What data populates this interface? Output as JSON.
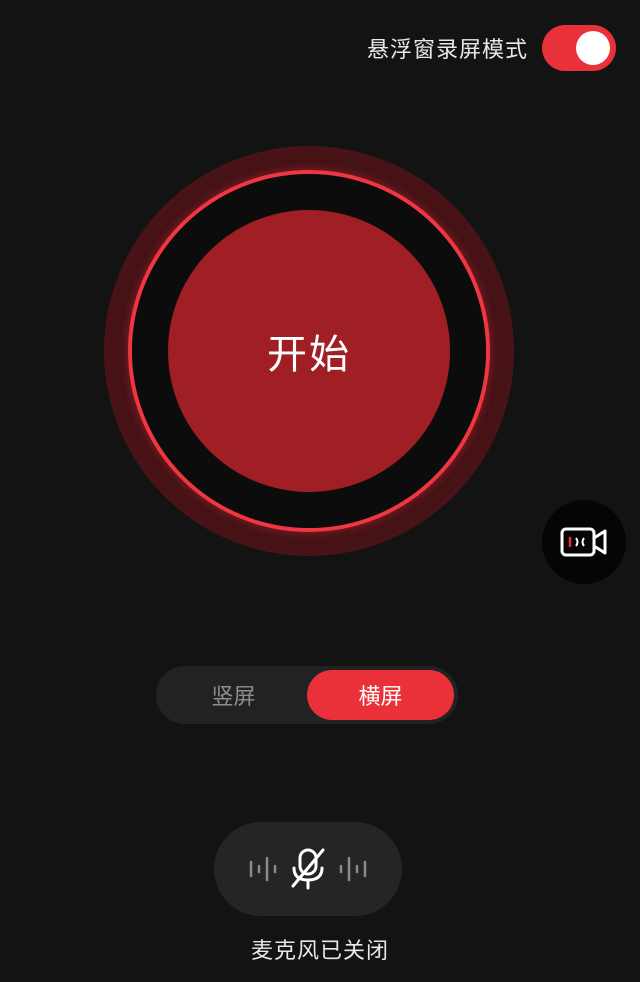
{
  "header": {
    "floating_mode_label": "悬浮窗录屏模式",
    "floating_mode_enabled": true
  },
  "record": {
    "start_label": "开始"
  },
  "side": {
    "camera_icon": "video-camera-icon"
  },
  "orientation": {
    "options": [
      "竖屏",
      "横屏"
    ],
    "selected": "横屏"
  },
  "mic": {
    "icon": "microphone-muted-icon",
    "status": "麦克风已关闭"
  },
  "colors": {
    "accent": "#ea3038",
    "button": "#a01f25",
    "background": "#131313"
  }
}
